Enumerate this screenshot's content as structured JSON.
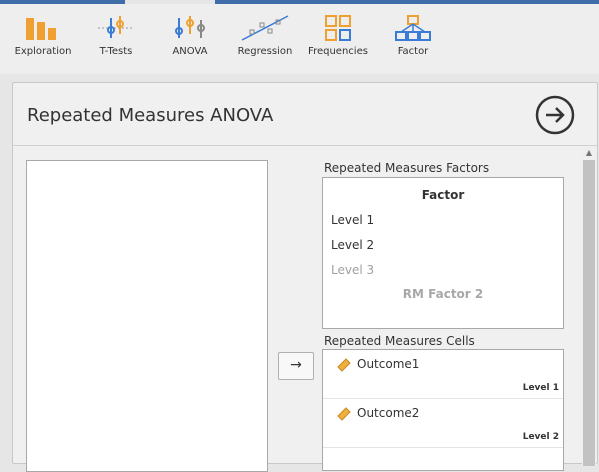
{
  "ribbon": {
    "items": [
      {
        "label": "Exploration",
        "icon": "exploration-icon"
      },
      {
        "label": "T-Tests",
        "icon": "t-tests-icon"
      },
      {
        "label": "ANOVA",
        "icon": "anova-icon"
      },
      {
        "label": "Regression",
        "icon": "regression-icon"
      },
      {
        "label": "Frequencies",
        "icon": "frequencies-icon"
      },
      {
        "label": "Factor",
        "icon": "factor-icon"
      }
    ]
  },
  "colors": {
    "accent": "#3e6da9",
    "icon_orange": "#f0a030",
    "icon_blue": "#3a7bd5"
  },
  "panel": {
    "title": "Repeated Measures ANOVA",
    "go_icon": "arrow-circle-right-icon"
  },
  "rm_factors": {
    "label": "Repeated Measures Factors",
    "factor_name": "Factor",
    "levels": [
      "Level 1",
      "Level 2"
    ],
    "level_placeholder": "Level 3",
    "factor_placeholder": "RM Factor 2"
  },
  "assign_button": {
    "label": "→"
  },
  "rm_cells": {
    "label": "Repeated Measures Cells",
    "cells": [
      {
        "name": "Outcome1",
        "level": "Level 1"
      },
      {
        "name": "Outcome2",
        "level": "Level 2"
      }
    ]
  }
}
